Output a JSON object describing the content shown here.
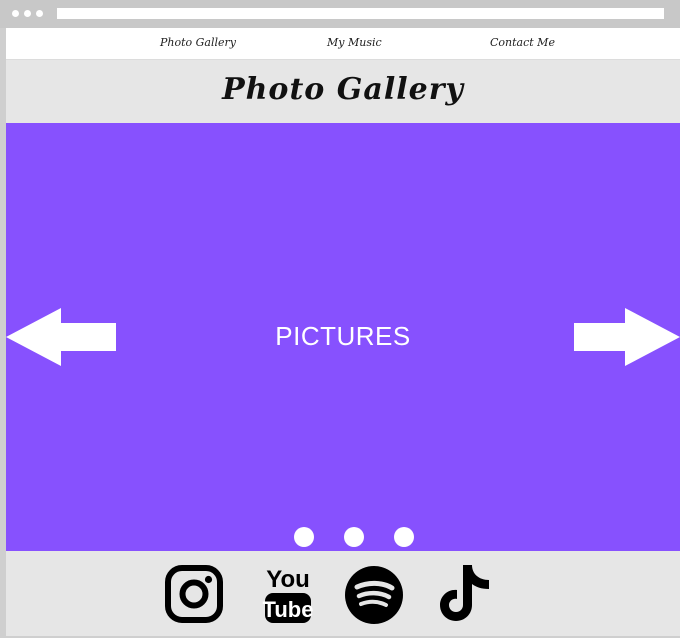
{
  "nav": {
    "items": [
      {
        "label": "Photo Gallery"
      },
      {
        "label": "My Music"
      },
      {
        "label": "Contact Me"
      }
    ]
  },
  "page": {
    "title": "Photo Gallery"
  },
  "carousel": {
    "label": "PICTURES",
    "background": "#8751fe",
    "indicator_count": 3
  },
  "footer": {
    "social": [
      {
        "icon": "instagram-icon"
      },
      {
        "icon": "youtube-icon",
        "text_top": "You",
        "text_bottom": "Tube"
      },
      {
        "icon": "spotify-icon"
      },
      {
        "icon": "tiktok-icon"
      }
    ]
  },
  "colors": {
    "chrome": "#c8c8c8",
    "band": "#e6e6e6",
    "accent": "#8751fe"
  }
}
